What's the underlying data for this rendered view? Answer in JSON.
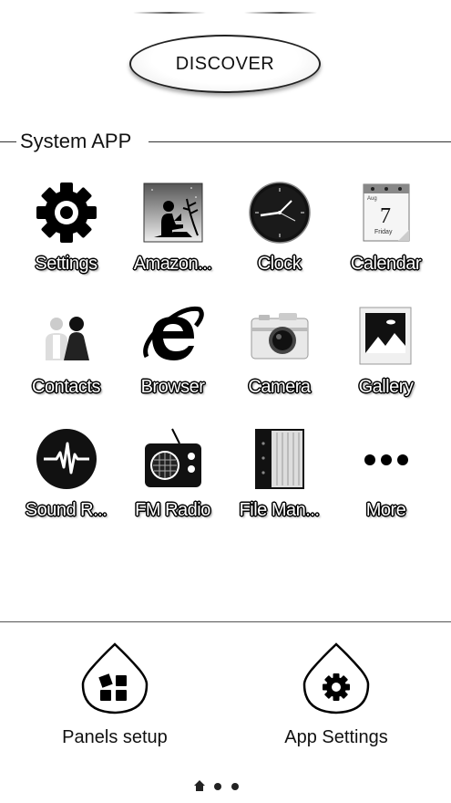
{
  "discover_label": "DISCOVER",
  "section_title": "System APP",
  "apps": [
    {
      "label": "Settings",
      "icon": "gear-icon"
    },
    {
      "label": "Amazon...",
      "icon": "kindle-reader-icon"
    },
    {
      "label": "Clock",
      "icon": "clock-icon"
    },
    {
      "label": "Calendar",
      "icon": "calendar-icon"
    },
    {
      "label": "Contacts",
      "icon": "contacts-icon"
    },
    {
      "label": "Browser",
      "icon": "browser-e-icon"
    },
    {
      "label": "Camera",
      "icon": "camera-icon"
    },
    {
      "label": "Gallery",
      "icon": "gallery-icon"
    },
    {
      "label": "Sound R...",
      "icon": "sound-recorder-icon"
    },
    {
      "label": "FM Radio",
      "icon": "radio-icon"
    },
    {
      "label": "File Man...",
      "icon": "file-manager-icon"
    },
    {
      "label": "More",
      "icon": "more-dots-icon"
    }
  ],
  "calendar_date": {
    "day": "7",
    "weekday": "Friday",
    "month": "Aug"
  },
  "bottom": {
    "panels_label": "Panels setup",
    "app_settings_label": "App Settings"
  }
}
